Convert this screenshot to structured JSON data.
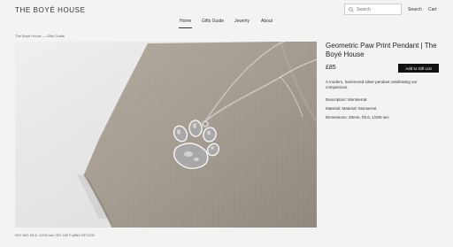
{
  "header": {
    "logo": "THE BOYÉ HOUSE",
    "search_placeholder": "Search",
    "search_link": "Search",
    "cart_link": "Cart"
  },
  "nav": {
    "items": [
      "Home",
      "Gifts Guide",
      "Jewelry",
      "About"
    ],
    "active": "Home"
  },
  "breadcrumb": "The Boyé House — Gifts Guide",
  "product": {
    "title": "Geometric Paw Print Pendant | The Boyé House",
    "price": "£85",
    "add_button": "Add to Gift List",
    "description": "A modern, hammered silver pendant celebrating our companions.",
    "specs": [
      "Description: Montserrat",
      "Material: Material: Monserrat",
      "Dimensions: 20mm, f/5.6, 1/200 sec"
    ]
  },
  "photo_caption": "ISO 160, f/5.6, 1/200 sec   ISO 160   Fujifilm GFX100",
  "icons": {
    "search": "search-icon",
    "paw_pendant": "paw-pendant-image"
  },
  "colors": {
    "background": "#f3f3f3",
    "button": "#111111",
    "linen": "#a59d93"
  }
}
